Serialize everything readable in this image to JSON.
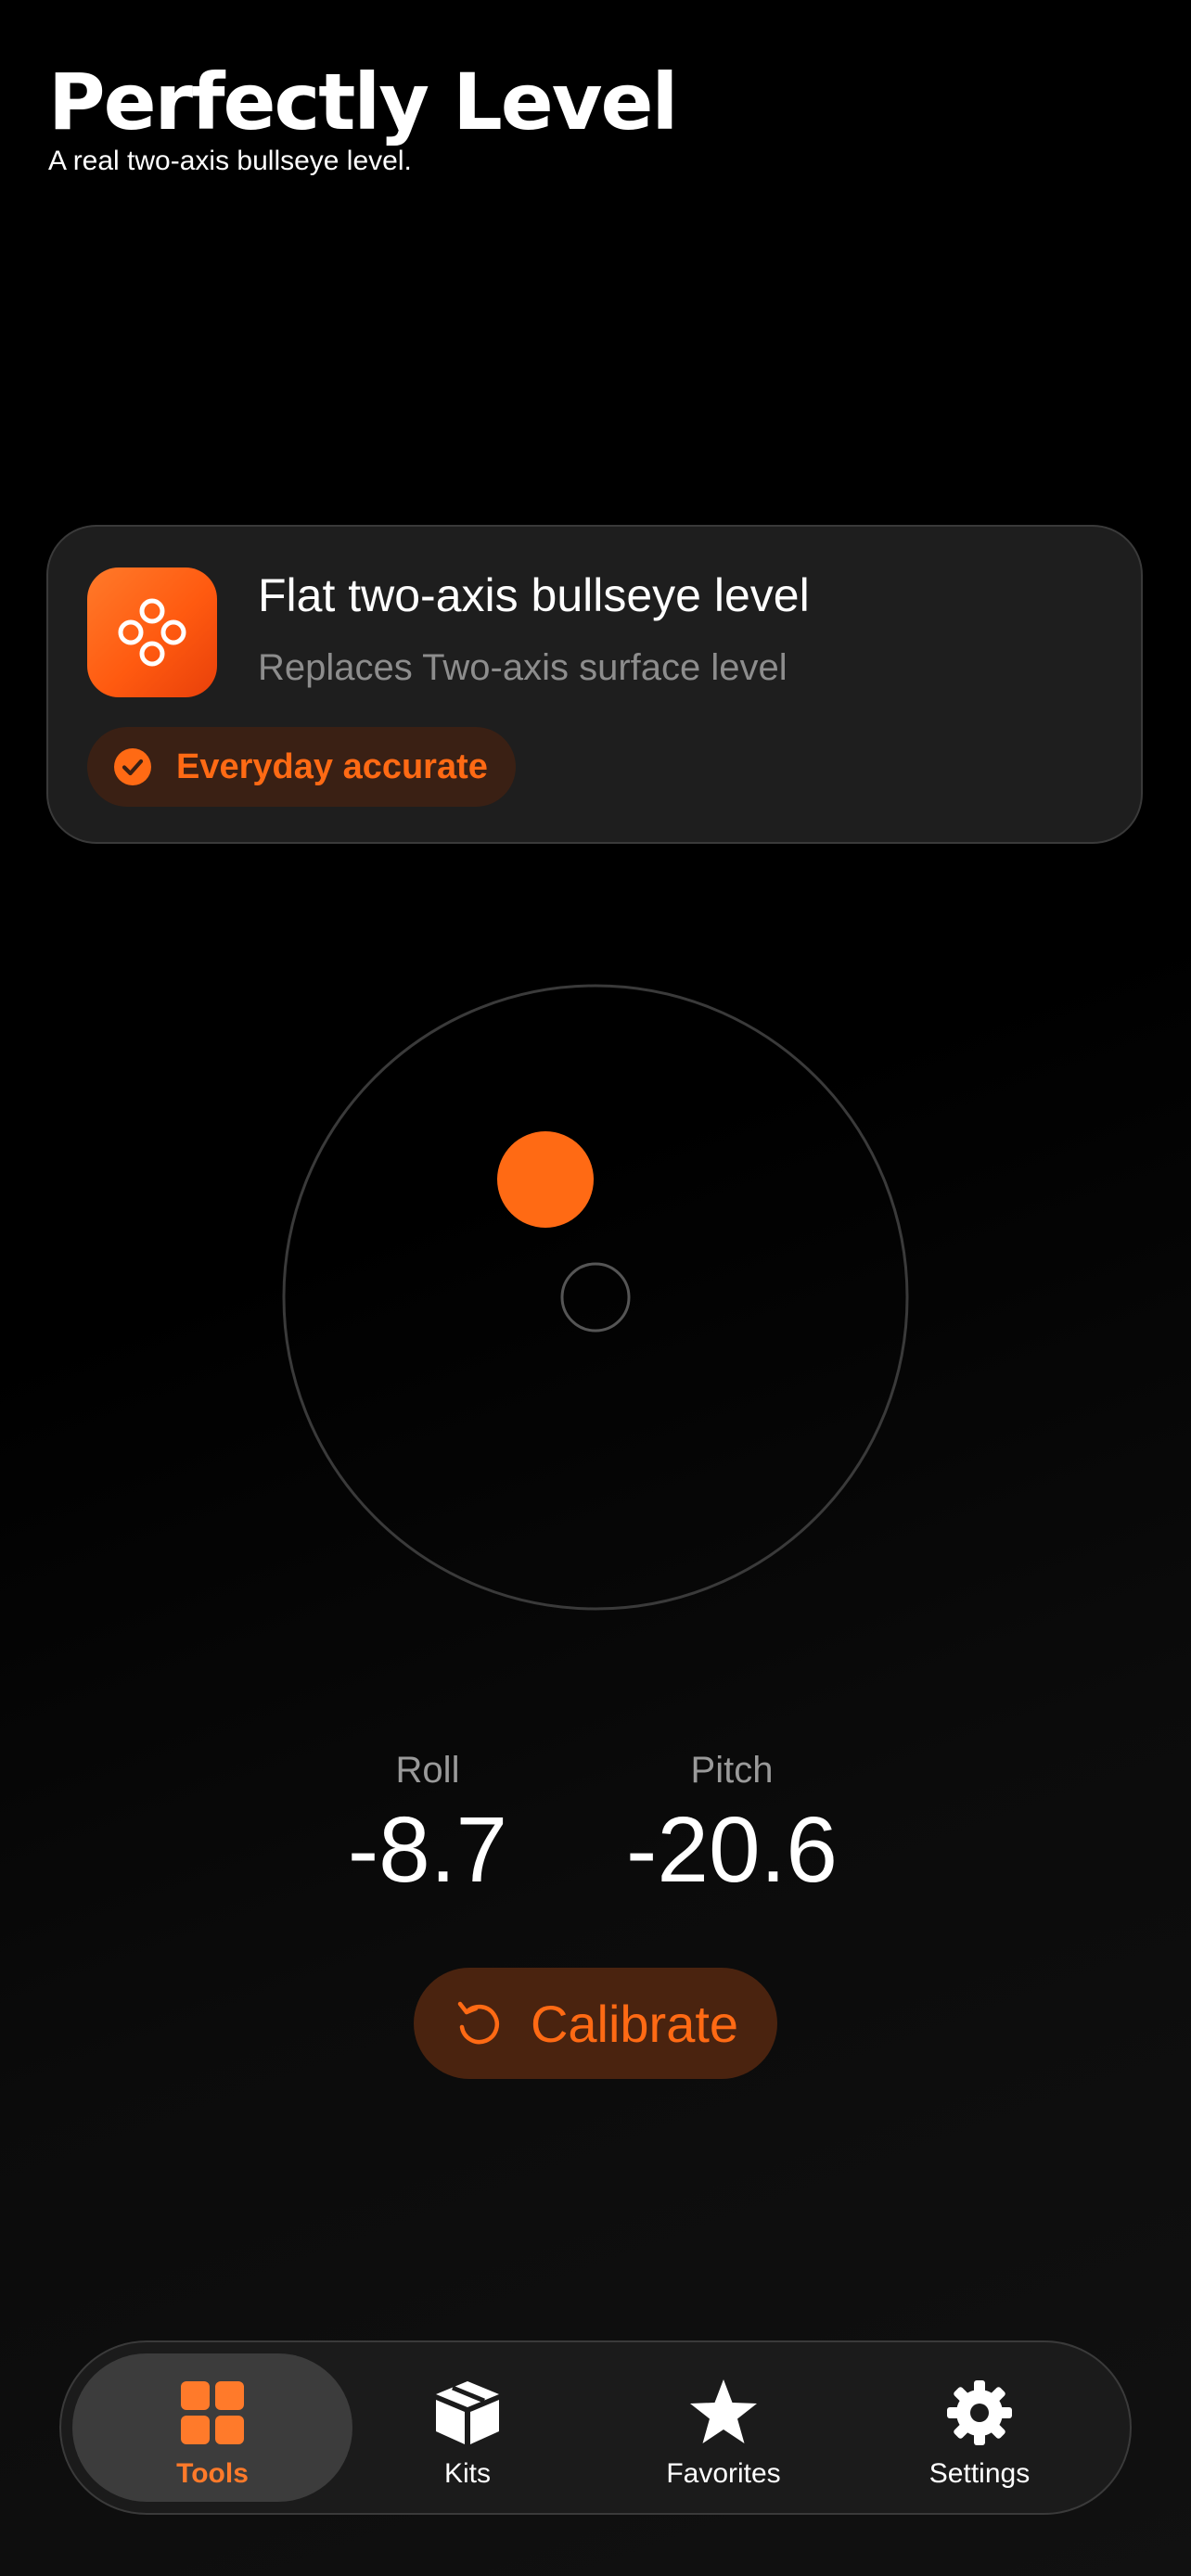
{
  "header": {
    "title": "Perfectly Level",
    "subtitle": "A real two-axis bullseye level."
  },
  "tool_card": {
    "icon": "four-circles-icon",
    "name": "Flat two-axis bullseye level",
    "replaces": "Replaces Two-axis surface level",
    "badge": {
      "icon": "checkmark-circle-icon",
      "label": "Everyday accurate"
    }
  },
  "readouts": {
    "roll": {
      "label": "Roll",
      "value": "-8.7"
    },
    "pitch": {
      "label": "Pitch",
      "value": "-20.6"
    }
  },
  "calibrate": {
    "icon": "rotate-ccw-icon",
    "label": "Calibrate"
  },
  "tab_bar": {
    "tabs": [
      {
        "label": "Tools",
        "icon": "grid-icon",
        "active": true
      },
      {
        "label": "Kits",
        "icon": "box-icon",
        "active": false
      },
      {
        "label": "Favorites",
        "icon": "star-icon",
        "active": false
      },
      {
        "label": "Settings",
        "icon": "gear-icon",
        "active": false
      }
    ]
  },
  "colors": {
    "accent": "#FF6A14",
    "background": "#000000",
    "card": "#1E1E1E",
    "secondary_text": "#8D8D8D"
  }
}
